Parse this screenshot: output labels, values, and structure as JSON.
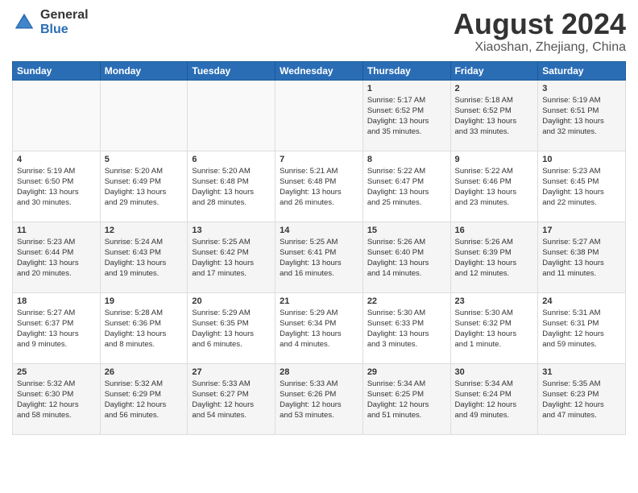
{
  "header": {
    "logo_general": "General",
    "logo_blue": "Blue",
    "month_title": "August 2024",
    "location": "Xiaoshan, Zhejiang, China"
  },
  "days_of_week": [
    "Sunday",
    "Monday",
    "Tuesday",
    "Wednesday",
    "Thursday",
    "Friday",
    "Saturday"
  ],
  "weeks": [
    [
      {
        "num": "",
        "info": ""
      },
      {
        "num": "",
        "info": ""
      },
      {
        "num": "",
        "info": ""
      },
      {
        "num": "",
        "info": ""
      },
      {
        "num": "1",
        "info": "Sunrise: 5:17 AM\nSunset: 6:52 PM\nDaylight: 13 hours\nand 35 minutes."
      },
      {
        "num": "2",
        "info": "Sunrise: 5:18 AM\nSunset: 6:52 PM\nDaylight: 13 hours\nand 33 minutes."
      },
      {
        "num": "3",
        "info": "Sunrise: 5:19 AM\nSunset: 6:51 PM\nDaylight: 13 hours\nand 32 minutes."
      }
    ],
    [
      {
        "num": "4",
        "info": "Sunrise: 5:19 AM\nSunset: 6:50 PM\nDaylight: 13 hours\nand 30 minutes."
      },
      {
        "num": "5",
        "info": "Sunrise: 5:20 AM\nSunset: 6:49 PM\nDaylight: 13 hours\nand 29 minutes."
      },
      {
        "num": "6",
        "info": "Sunrise: 5:20 AM\nSunset: 6:48 PM\nDaylight: 13 hours\nand 28 minutes."
      },
      {
        "num": "7",
        "info": "Sunrise: 5:21 AM\nSunset: 6:48 PM\nDaylight: 13 hours\nand 26 minutes."
      },
      {
        "num": "8",
        "info": "Sunrise: 5:22 AM\nSunset: 6:47 PM\nDaylight: 13 hours\nand 25 minutes."
      },
      {
        "num": "9",
        "info": "Sunrise: 5:22 AM\nSunset: 6:46 PM\nDaylight: 13 hours\nand 23 minutes."
      },
      {
        "num": "10",
        "info": "Sunrise: 5:23 AM\nSunset: 6:45 PM\nDaylight: 13 hours\nand 22 minutes."
      }
    ],
    [
      {
        "num": "11",
        "info": "Sunrise: 5:23 AM\nSunset: 6:44 PM\nDaylight: 13 hours\nand 20 minutes."
      },
      {
        "num": "12",
        "info": "Sunrise: 5:24 AM\nSunset: 6:43 PM\nDaylight: 13 hours\nand 19 minutes."
      },
      {
        "num": "13",
        "info": "Sunrise: 5:25 AM\nSunset: 6:42 PM\nDaylight: 13 hours\nand 17 minutes."
      },
      {
        "num": "14",
        "info": "Sunrise: 5:25 AM\nSunset: 6:41 PM\nDaylight: 13 hours\nand 16 minutes."
      },
      {
        "num": "15",
        "info": "Sunrise: 5:26 AM\nSunset: 6:40 PM\nDaylight: 13 hours\nand 14 minutes."
      },
      {
        "num": "16",
        "info": "Sunrise: 5:26 AM\nSunset: 6:39 PM\nDaylight: 13 hours\nand 12 minutes."
      },
      {
        "num": "17",
        "info": "Sunrise: 5:27 AM\nSunset: 6:38 PM\nDaylight: 13 hours\nand 11 minutes."
      }
    ],
    [
      {
        "num": "18",
        "info": "Sunrise: 5:27 AM\nSunset: 6:37 PM\nDaylight: 13 hours\nand 9 minutes."
      },
      {
        "num": "19",
        "info": "Sunrise: 5:28 AM\nSunset: 6:36 PM\nDaylight: 13 hours\nand 8 minutes."
      },
      {
        "num": "20",
        "info": "Sunrise: 5:29 AM\nSunset: 6:35 PM\nDaylight: 13 hours\nand 6 minutes."
      },
      {
        "num": "21",
        "info": "Sunrise: 5:29 AM\nSunset: 6:34 PM\nDaylight: 13 hours\nand 4 minutes."
      },
      {
        "num": "22",
        "info": "Sunrise: 5:30 AM\nSunset: 6:33 PM\nDaylight: 13 hours\nand 3 minutes."
      },
      {
        "num": "23",
        "info": "Sunrise: 5:30 AM\nSunset: 6:32 PM\nDaylight: 13 hours\nand 1 minute."
      },
      {
        "num": "24",
        "info": "Sunrise: 5:31 AM\nSunset: 6:31 PM\nDaylight: 12 hours\nand 59 minutes."
      }
    ],
    [
      {
        "num": "25",
        "info": "Sunrise: 5:32 AM\nSunset: 6:30 PM\nDaylight: 12 hours\nand 58 minutes."
      },
      {
        "num": "26",
        "info": "Sunrise: 5:32 AM\nSunset: 6:29 PM\nDaylight: 12 hours\nand 56 minutes."
      },
      {
        "num": "27",
        "info": "Sunrise: 5:33 AM\nSunset: 6:27 PM\nDaylight: 12 hours\nand 54 minutes."
      },
      {
        "num": "28",
        "info": "Sunrise: 5:33 AM\nSunset: 6:26 PM\nDaylight: 12 hours\nand 53 minutes."
      },
      {
        "num": "29",
        "info": "Sunrise: 5:34 AM\nSunset: 6:25 PM\nDaylight: 12 hours\nand 51 minutes."
      },
      {
        "num": "30",
        "info": "Sunrise: 5:34 AM\nSunset: 6:24 PM\nDaylight: 12 hours\nand 49 minutes."
      },
      {
        "num": "31",
        "info": "Sunrise: 5:35 AM\nSunset: 6:23 PM\nDaylight: 12 hours\nand 47 minutes."
      }
    ]
  ]
}
